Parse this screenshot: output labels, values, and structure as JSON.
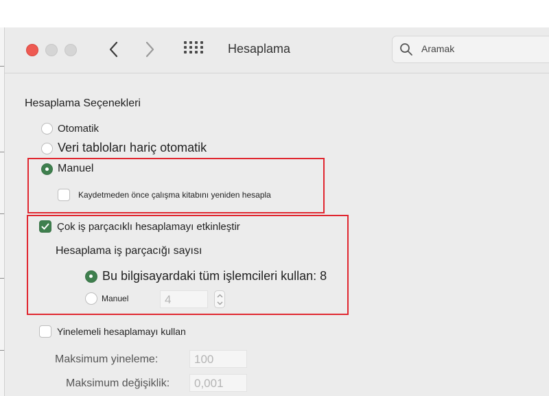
{
  "window": {
    "title": "Hesaplama",
    "search_placeholder": "Aramak"
  },
  "section": {
    "title": "Hesaplama Seçenekleri"
  },
  "calc_mode": {
    "selected": "Manuel",
    "options": [
      {
        "label": "Otomatik",
        "selected": false
      },
      {
        "label": "Veri tabloları hariç otomatik",
        "selected": false
      },
      {
        "label": "Manuel",
        "selected": true
      }
    ],
    "recalc_before_save": {
      "label": "Kaydetmeden önce çalışma kitabını yeniden hesapla",
      "checked": false
    }
  },
  "multithread": {
    "label": "Çok iş parçacıklı hesaplamayı etkinleştir",
    "checked": true,
    "threads_heading": "Hesaplama iş parçacığı sayısı",
    "use_all_label": "Bu bilgisayardaki tüm işlemcileri kullan: 8",
    "use_all_selected": true,
    "manual_label": "Manuel",
    "manual_selected": false,
    "manual_value": "4"
  },
  "iterative": {
    "label": "Yinelemeli hesaplamayı kullan",
    "checked": false,
    "max_iterations_label": "Maksimum yineleme:",
    "max_iterations_value": "100",
    "max_change_label": "Maksimum değişiklik:",
    "max_change_value": "0,001"
  },
  "colors": {
    "accent_green": "#3f7f4e",
    "highlight_red": "#e0262f",
    "close_red": "#ee5a52"
  },
  "icons": [
    "close-icon",
    "minimize-icon",
    "zoom-icon",
    "chevron-left-icon",
    "chevron-right-icon",
    "grid-icon",
    "search-icon",
    "checkmark-icon",
    "stepper-up-icon",
    "stepper-down-icon"
  ]
}
